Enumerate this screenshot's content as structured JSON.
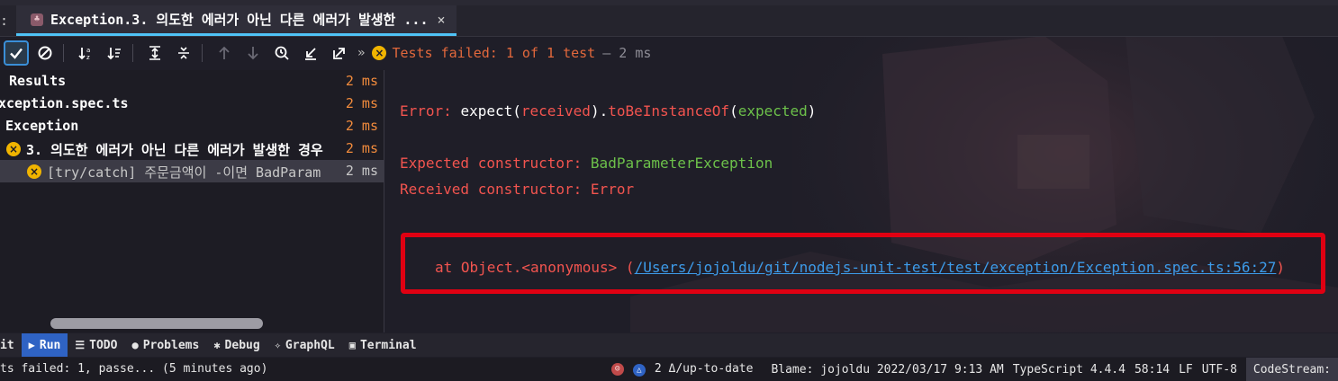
{
  "tab_bar": {
    "prefix": ":",
    "active_tab": {
      "label": "Exception.3. 의도한 에러가 아닌 다른 에러가 발생한 ...",
      "close": "×"
    }
  },
  "toolbar": {
    "more": "»",
    "status_label": "Tests failed: 1 of 1 test",
    "status_time": "– 2 ms",
    "icons": [
      "check-icon",
      "cancel-icon",
      "sort-alpha-icon",
      "sort-duration-icon",
      "expand-all-icon",
      "collapse-all-icon",
      "arrow-up-icon",
      "arrow-down-icon",
      "history-icon",
      "import-icon",
      "export-icon"
    ]
  },
  "test_tree": {
    "rows": [
      {
        "label": "Results",
        "time": "2 ms"
      },
      {
        "label": "xception.spec.ts",
        "time": "2 ms"
      },
      {
        "label": "Exception",
        "time": "2 ms"
      },
      {
        "label": "3. 의도한 에러가 아닌 다른 에러가 발생한 경우",
        "time": "2 ms"
      },
      {
        "label": "[try/catch] 주문금액이 -이면 BadParam",
        "time": "2 ms"
      }
    ],
    "failed_icon": "×"
  },
  "output": {
    "error_prefix": "Error: ",
    "expect": "expect(",
    "received": "received",
    "close_paren_dot": ").",
    "to_be_instance_of": "toBeInstanceOf",
    "open_paren": "(",
    "expected": "expected",
    "close_paren": ")",
    "expected_constructor_label": "Expected constructor: ",
    "expected_constructor_value": "BadParameterException",
    "received_constructor_label": "Received constructor: ",
    "received_constructor_value": "Error",
    "stack_prefix": "at Object.<anonymous> (",
    "stack_link": "/Users/jojoldu/git/nodejs-unit-test/test/exception/Exception.spec.ts:56:27",
    "stack_suffix": ")"
  },
  "bottom_tabs": [
    {
      "label": "it",
      "icon": ""
    },
    {
      "label": "Run",
      "icon": "▶"
    },
    {
      "label": "TODO",
      "icon": "☰"
    },
    {
      "label": "Problems",
      "icon": "●"
    },
    {
      "label": "Debug",
      "icon": "✱"
    },
    {
      "label": "GraphQL",
      "icon": "✧"
    },
    {
      "label": "Terminal",
      "icon": "▣"
    }
  ],
  "status_bar": {
    "left": "ts failed: 1, passe... (5 minutes ago)",
    "vcs_count": "2 Δ/up-to-date",
    "blame": "Blame: jojoldu 2022/03/17 9:13 AM",
    "language": "TypeScript 4.4.4",
    "position": "58:14",
    "line_ending": "LF",
    "encoding": "UTF-8",
    "codestream": "CodeStream:"
  },
  "colors": {
    "accent": "#3a8fd8",
    "error_red": "#f2544f",
    "success_green": "#6cc04a",
    "time_orange": "#f28b3c",
    "highlight_box": "#e00012",
    "link_blue": "#3d9be9"
  }
}
